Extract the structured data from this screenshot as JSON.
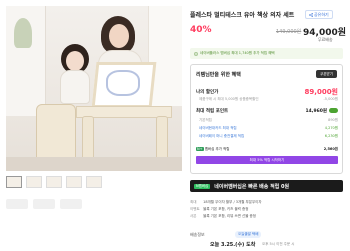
{
  "product": {
    "title": "플레스타 멀티테스크 유아 책상 의자 세트",
    "share_label": "공유하기",
    "discount": "40%",
    "original_price": "149,000원",
    "sale_price": "94,000원",
    "shipping_note": "무료배송"
  },
  "benefit_banner": {
    "text": "네이버플러스 멤버십 최대 1,740원 추가 적립 혜택"
  },
  "benefit_box": {
    "header": "리템님만을 위한 혜택",
    "coupon_button": "쿠폰받기",
    "rows": [
      {
        "label": "나의 할인가",
        "value": "89,000원"
      },
      {
        "label": "최대 적립 포인트",
        "value": "14,960원"
      }
    ],
    "sub_rows": [
      {
        "label": "제품구매 시 최대 5,000원 상품중복할인",
        "value": "-5,000원"
      },
      {
        "label": "기본적립",
        "value": "890원"
      },
      {
        "label": "네이버현대카드 최대 적립",
        "value": "4,270원"
      },
      {
        "label": "네이버페이 머니 충전결제 적립",
        "value": "6,230원"
      }
    ],
    "purple_row": {
      "tag": "N+",
      "label": "멤버십 추가 적립",
      "value": "2,560원"
    },
    "purple_bar": "최대 5% 적립 시작하기"
  },
  "membership_banner": {
    "logo": "N멤버십",
    "text": "네이버멤버십은 빠른 배송 적립 0원"
  },
  "info_list": [
    {
      "label": "최대",
      "value": "18개월 무이자 할부 / 3개월 부분무이자"
    },
    {
      "label": "이벤트",
      "value": "블록 기본 포함, 키즈 블럭 증정"
    },
    {
      "label": "사은",
      "value": "블록 기본 포함, 리뷰 쓰면 선물 증정"
    }
  ],
  "delivery": {
    "label": "배송정보",
    "pill": "오늘출발 택배",
    "arrival": "오늘 3.25.(수) 도착",
    "arrival_sub": "오후 5시 이전 주문 시"
  },
  "colors": {
    "accent_red": "#ff3c5f",
    "green": "#4ca331",
    "purple": "#9146e6",
    "dark_banner": "#1b1b1b"
  }
}
